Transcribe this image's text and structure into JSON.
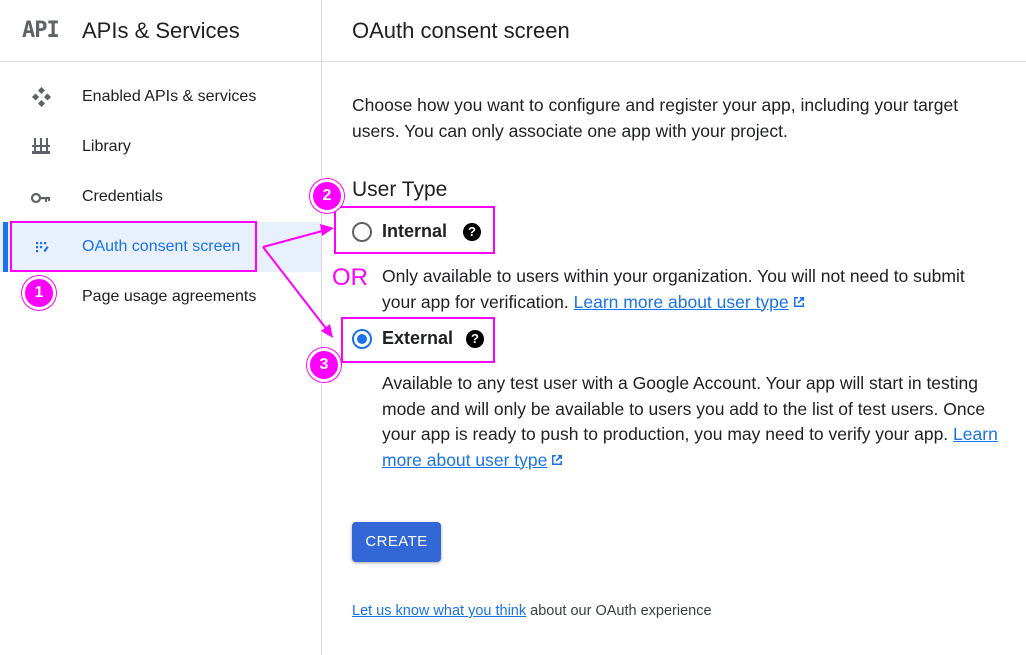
{
  "sidebar": {
    "logo_text": "API",
    "title": "APIs & Services",
    "items": [
      {
        "label": "Enabled APIs & services",
        "icon": "enabled-apis-icon",
        "active": false
      },
      {
        "label": "Library",
        "icon": "library-icon",
        "active": false
      },
      {
        "label": "Credentials",
        "icon": "key-icon",
        "active": false
      },
      {
        "label": "OAuth consent screen",
        "icon": "oauth-consent-icon",
        "active": true
      },
      {
        "label": "Page usage agreements",
        "icon": "page-usage-icon",
        "active": false
      }
    ]
  },
  "main": {
    "page_title": "OAuth consent screen",
    "intro": "Choose how you want to configure and register your app, including your target users. You can only associate one app with your project.",
    "user_type_title": "User Type",
    "options": [
      {
        "label": "Internal",
        "selected": false,
        "description": "Only available to users within your organization. You will not need to submit your app for verification.",
        "link": "Learn more about user type"
      },
      {
        "label": "External",
        "selected": true,
        "description": "Available to any test user with a Google Account. Your app will start in testing mode and will only be available to users you add to the list of test users. Once your app is ready to push to production, you may need to verify your app.",
        "link": "Learn more about user type"
      }
    ],
    "create_label": "CREATE",
    "feedback_link": "Let us know what you think",
    "feedback_text": "about our OAuth experience"
  },
  "annotations": {
    "step1": "1",
    "step2": "2",
    "step3": "3",
    "or_label": "OR",
    "color": "#ff00ff"
  },
  "colors": {
    "accent": "#1a73e8",
    "button": "#3367d6",
    "active_bg": "#e8f0fe",
    "divider": "#dadce0"
  }
}
